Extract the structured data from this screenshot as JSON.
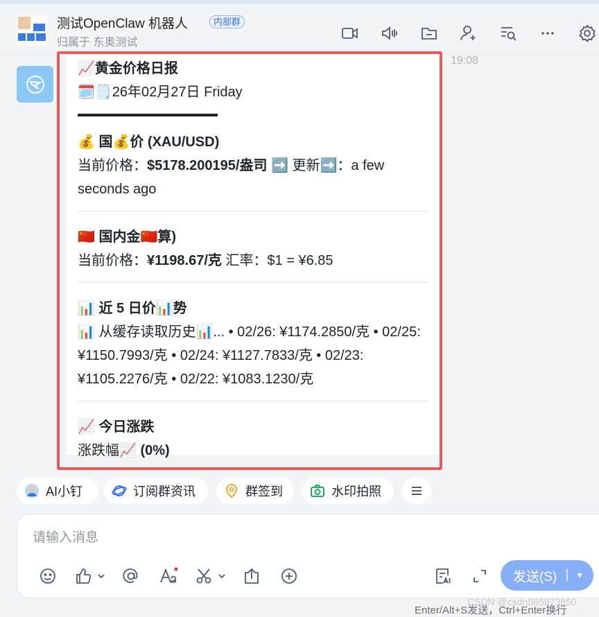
{
  "header": {
    "title": "测试OpenClaw 机器人",
    "tag": "内部群",
    "subtitle": "归属于 东奥测试"
  },
  "chat": {
    "timestamp": "19:08",
    "message": {
      "title": "📈黄金价格日报",
      "date_line": "🗓️🗒️26年02月27日 Friday",
      "sections": [
        {
          "heading": "💰 国💰价 (XAU/USD)",
          "line_prefix": "当前价格：",
          "line_value": "$5178.200195/盎司",
          "line_suffix": " ➡️ 更新➡️：a few seconds ago"
        },
        {
          "heading": "🇨🇳 国内金🇨🇳算)",
          "line_prefix": "当前价格：",
          "line_value": "¥1198.67/克",
          "line_suffix": " 汇率：$1 = ¥6.85"
        },
        {
          "heading": "📊 近 5 日价📊势",
          "body": "📊 从缓存读取历史📊... • 02/26: ¥1174.2850/克 • 02/25: ¥1150.7993/克 • 02/24: ¥1127.7833/克 • 02/23: ¥1105.2276/克 • 02/22: ¥1083.1230/克"
        },
        {
          "heading": "📈 今日涨跌",
          "line_prefix": "涨跌幅📈 ",
          "line_value": "(0%)"
        }
      ]
    }
  },
  "quick_actions": [
    {
      "label": "AI小钉",
      "icon": "ai-avatar-icon"
    },
    {
      "label": "订阅群资讯",
      "icon": "subscribe-icon"
    },
    {
      "label": "群签到",
      "icon": "location-pin-icon"
    },
    {
      "label": "水印拍照",
      "icon": "camera-icon"
    }
  ],
  "composer": {
    "placeholder": "请输入消息",
    "send_label": "发送(S)"
  },
  "footer_hint": "Enter/Alt+S发送，Ctrl+Enter换行",
  "watermark": "CSDN @csdn565973850",
  "colors": {
    "accent": "#3370ff",
    "send": "#86aff8",
    "highlight_border": "#e85a5a"
  }
}
